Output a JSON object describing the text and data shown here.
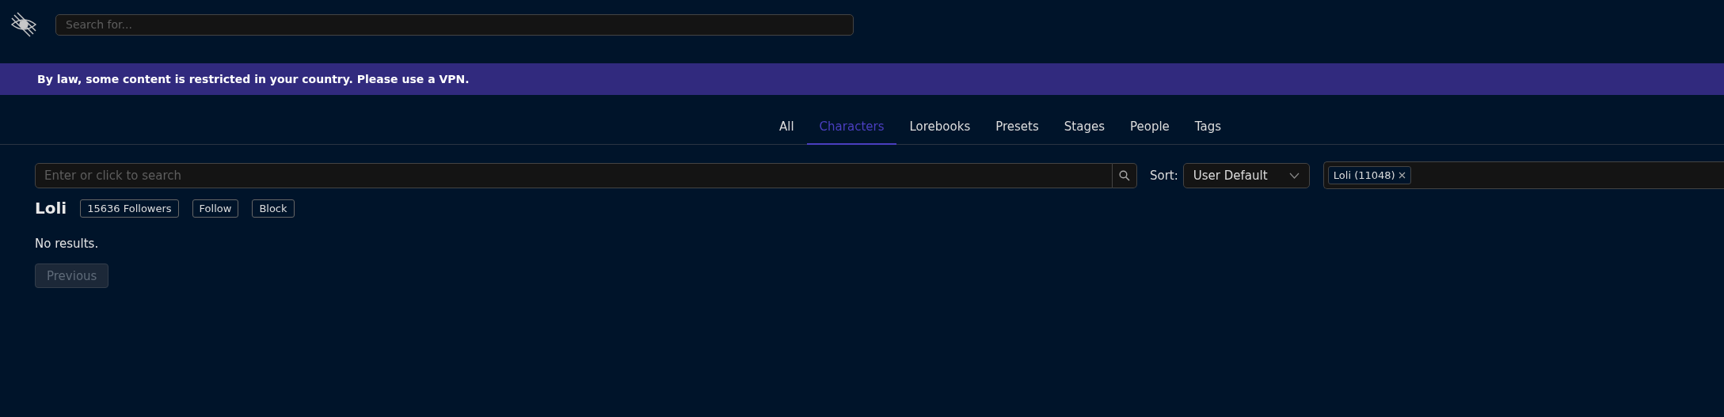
{
  "header": {
    "search": {
      "placeholder": "Search for..."
    }
  },
  "banner": "By law, some content is restricted in your country. Please use a VPN.",
  "tabs": [
    {
      "label": "All",
      "selected": false
    },
    {
      "label": "Characters",
      "selected": true
    },
    {
      "label": "Lorebooks",
      "selected": false
    },
    {
      "label": "Presets",
      "selected": false
    },
    {
      "label": "Stages",
      "selected": false
    },
    {
      "label": "People",
      "selected": false
    },
    {
      "label": "Tags",
      "selected": false
    }
  ],
  "search": {
    "placeholder": "Enter or click to search"
  },
  "sort": {
    "label": "Sort:",
    "value": "User Default"
  },
  "tag_filter": {
    "chips": [
      {
        "label": "Loli (11048)"
      }
    ]
  },
  "tag": {
    "name": "Loli",
    "followers": "15636 Followers",
    "buttons": [
      "Follow",
      "Block"
    ]
  },
  "empty_message": "No results.",
  "pagination": {
    "previous": {
      "label": "Previous",
      "disabled": true
    }
  }
}
